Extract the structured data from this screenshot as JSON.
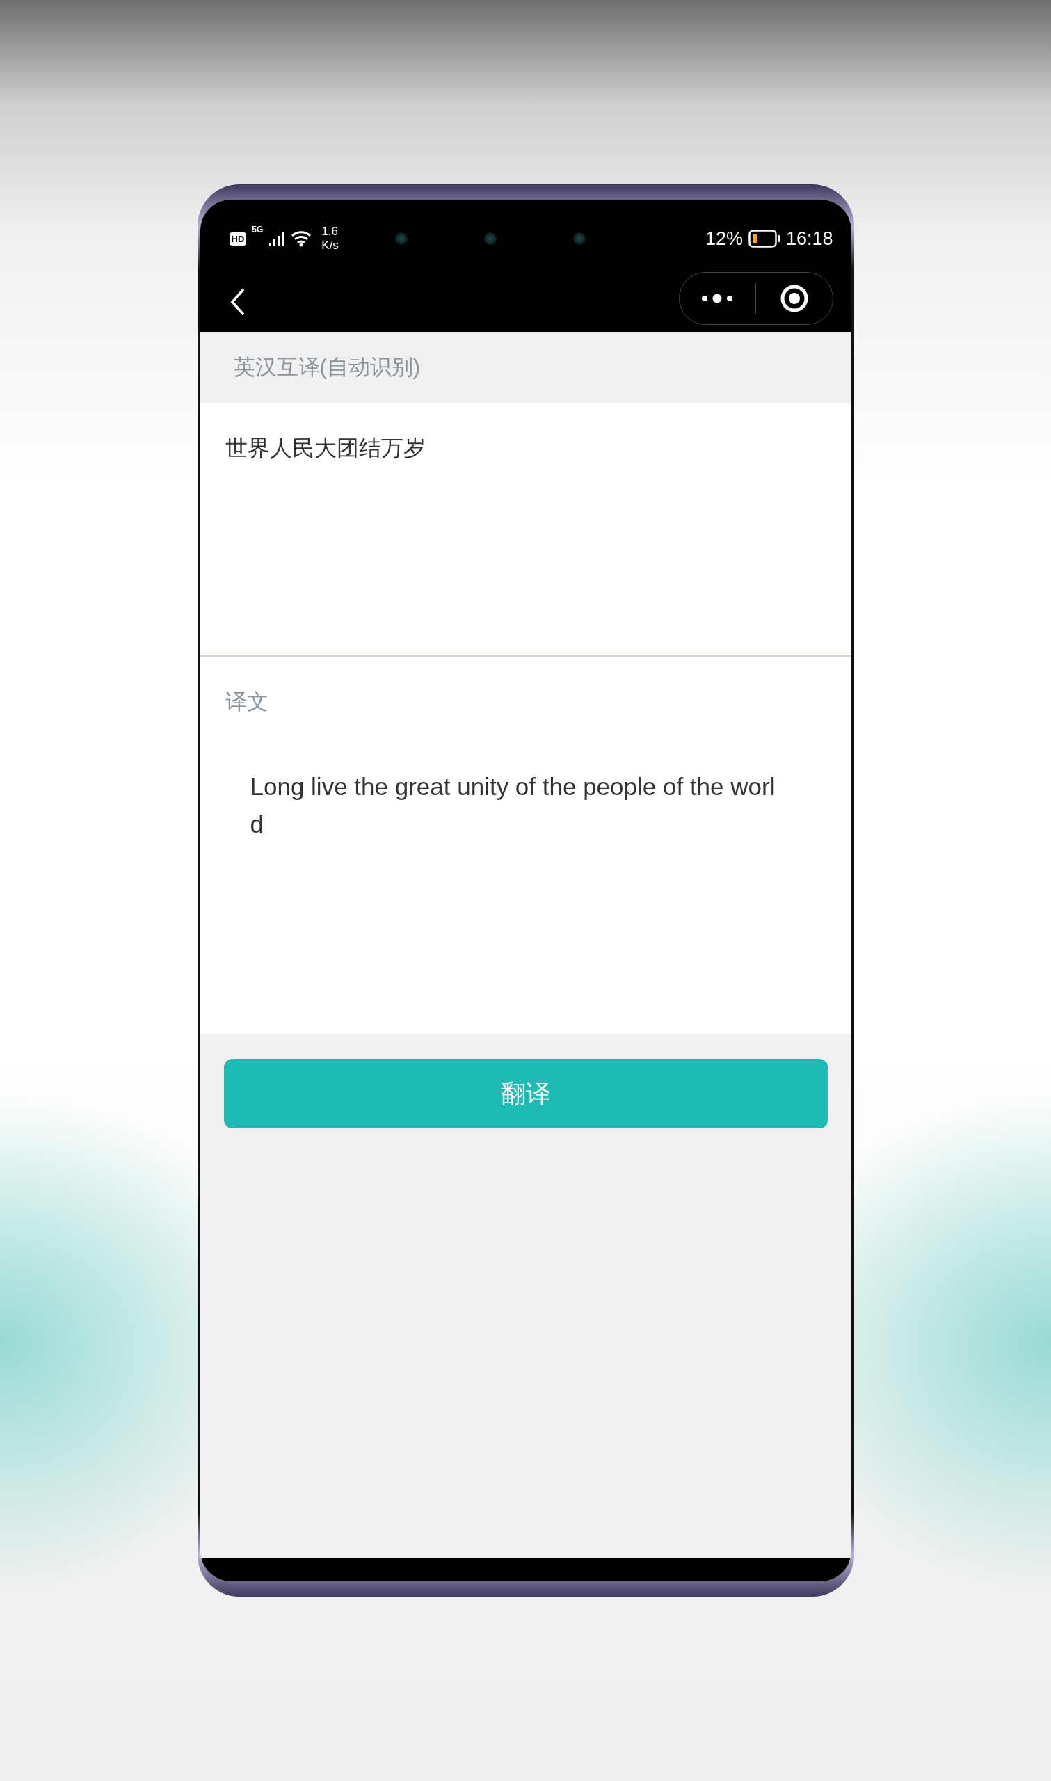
{
  "status_bar": {
    "hd": "HD",
    "network": "5G",
    "speed_value": "1.6",
    "speed_unit": "K/s",
    "battery": "12%",
    "time": "16:18"
  },
  "header": {
    "title": "英汉互译(自动识别)"
  },
  "source": {
    "value": "世界人民大团结万岁"
  },
  "result": {
    "label": "译文",
    "text": "Long live the great unity of the people of the world"
  },
  "button": {
    "label": "翻译"
  }
}
